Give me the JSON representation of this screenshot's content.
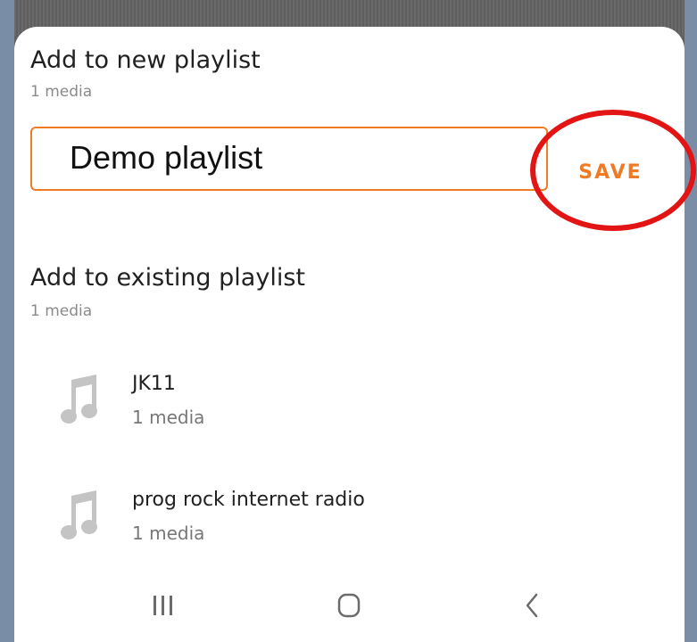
{
  "new_playlist": {
    "title": "Add to new playlist",
    "subtitle": "1 media",
    "input_value": "Demo playlist",
    "save_label": "SAVE"
  },
  "existing_playlist": {
    "title": "Add to existing playlist",
    "subtitle": "1 media",
    "items": [
      {
        "title": "JK11",
        "subtitle": "1 media",
        "icon": "music-note-icon"
      },
      {
        "title": "prog rock internet radio",
        "subtitle": "1 media",
        "icon": "music-note-icon"
      }
    ]
  },
  "nav": {
    "recent": "recent-apps-icon",
    "home": "home-icon",
    "back": "back-icon"
  },
  "colors": {
    "accent": "#f07b24",
    "highlight_ring": "#e21414",
    "icon_gray": "#c4c4c4"
  }
}
